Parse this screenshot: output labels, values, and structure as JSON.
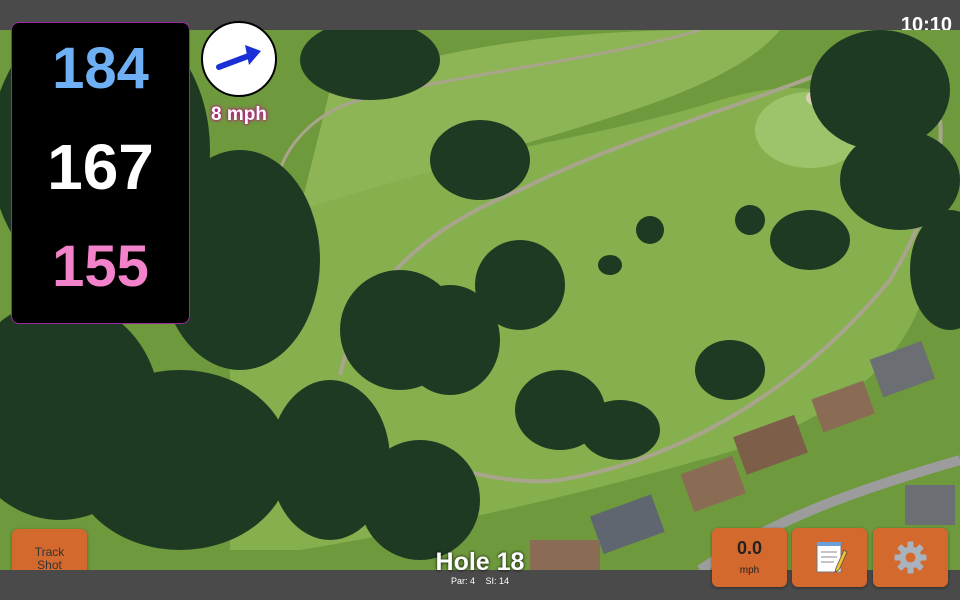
{
  "status_bar": {
    "time": "10:10"
  },
  "distances": {
    "back": "184",
    "middle": "167",
    "front": "155"
  },
  "wind": {
    "speed": "8 mph",
    "icon": "wind-direction-arrow-icon"
  },
  "buttons": {
    "track_shot_line1": "Track",
    "track_shot_line2": "Shot",
    "speed_value": "0.0",
    "speed_unit": "mph",
    "notes_icon": "notepad-icon",
    "settings_icon": "gear-icon"
  },
  "hole": {
    "title": "Hole 18",
    "par": "Par: 4",
    "si": "SI: 14"
  },
  "colors": {
    "back_distance": "#6fb0f5",
    "middle_distance": "#ffffff",
    "front_distance": "#f282c9",
    "button_orange": "#d4692e",
    "panel_border": "#9b2aa0"
  }
}
